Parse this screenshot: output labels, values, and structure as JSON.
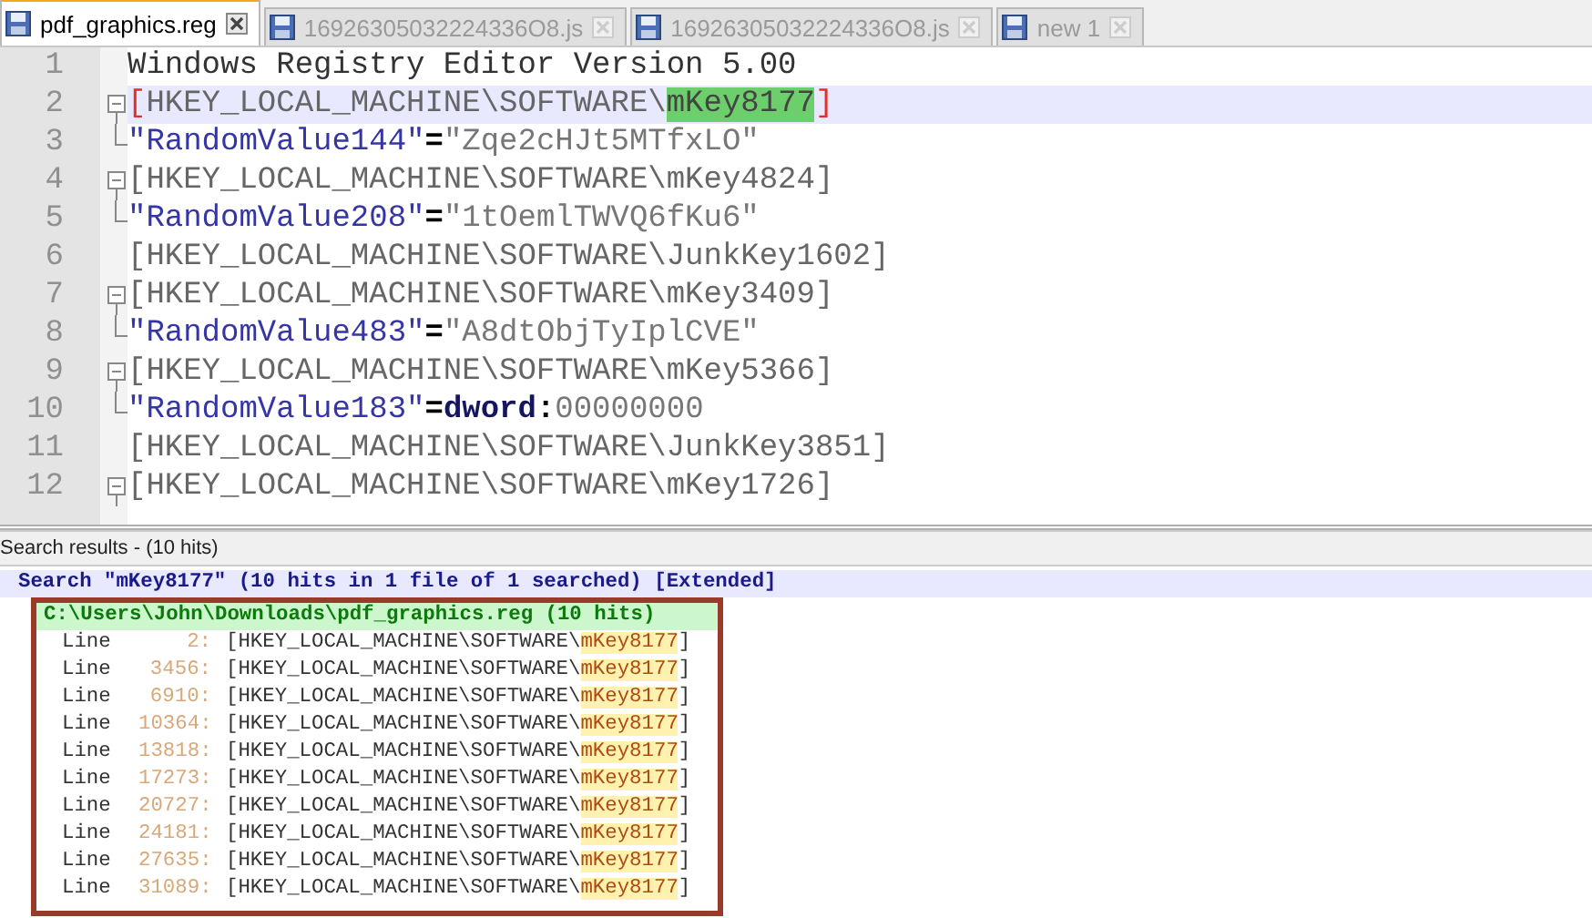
{
  "tabs": [
    {
      "label": "pdf_graphics.reg",
      "selected": true
    },
    {
      "label": "16926305032224336O8.js",
      "selected": false
    },
    {
      "label": "16926305032224336O8.js",
      "selected": false
    },
    {
      "label": "new 1",
      "selected": false
    }
  ],
  "editor": {
    "lines": [
      {
        "number": "1",
        "current": false,
        "segments": [
          {
            "kind": "plain",
            "text": "Windows Registry Editor Version 5.00"
          }
        ]
      },
      {
        "number": "2",
        "kind": "fold-start",
        "current": true,
        "segments": [
          {
            "kind": "brace",
            "text": "["
          },
          {
            "kind": "key",
            "text": "HKEY_LOCAL_MACHINE\\SOFTWARE\\"
          },
          {
            "kind": "match",
            "text": "mKey8177"
          },
          {
            "kind": "brace",
            "text": "]"
          }
        ]
      },
      {
        "number": "3",
        "kind": "fold-end",
        "current": false,
        "segments": [
          {
            "kind": "name",
            "text": "\"RandomValue144\""
          },
          {
            "kind": "op",
            "text": "="
          },
          {
            "kind": "string",
            "text": "\"Zqe2cHJt5MTfxLO\""
          }
        ]
      },
      {
        "number": "4",
        "kind": "fold-start",
        "current": false,
        "segments": [
          {
            "kind": "key",
            "text": "[HKEY_LOCAL_MACHINE\\SOFTWARE\\mKey4824]"
          }
        ]
      },
      {
        "number": "5",
        "kind": "fold-end",
        "current": false,
        "segments": [
          {
            "kind": "name",
            "text": "\"RandomValue208\""
          },
          {
            "kind": "op",
            "text": "="
          },
          {
            "kind": "string",
            "text": "\"1tOemlTWVQ6fKu6\""
          }
        ]
      },
      {
        "number": "6",
        "current": false,
        "segments": [
          {
            "kind": "key",
            "text": "[HKEY_LOCAL_MACHINE\\SOFTWARE\\JunkKey1602]"
          }
        ]
      },
      {
        "number": "7",
        "kind": "fold-start",
        "current": false,
        "segments": [
          {
            "kind": "key",
            "text": "[HKEY_LOCAL_MACHINE\\SOFTWARE\\mKey3409]"
          }
        ]
      },
      {
        "number": "8",
        "kind": "fold-end",
        "current": false,
        "segments": [
          {
            "kind": "name",
            "text": "\"RandomValue483\""
          },
          {
            "kind": "op",
            "text": "="
          },
          {
            "kind": "string",
            "text": "\"A8dtObjTyIplCVE\""
          }
        ]
      },
      {
        "number": "9",
        "kind": "fold-start",
        "current": false,
        "segments": [
          {
            "kind": "key",
            "text": "[HKEY_LOCAL_MACHINE\\SOFTWARE\\mKey5366]"
          }
        ]
      },
      {
        "number": "10",
        "kind": "fold-end",
        "current": false,
        "segments": [
          {
            "kind": "name",
            "text": "\"RandomValue183\""
          },
          {
            "kind": "op",
            "text": "="
          },
          {
            "kind": "type",
            "text": "dword"
          },
          {
            "kind": "op",
            "text": ":"
          },
          {
            "kind": "string",
            "text": "00000000"
          }
        ]
      },
      {
        "number": "11",
        "current": false,
        "segments": [
          {
            "kind": "key",
            "text": "[HKEY_LOCAL_MACHINE\\SOFTWARE\\JunkKey3851]"
          }
        ]
      },
      {
        "number": "12",
        "kind": "fold-start",
        "current": false,
        "segments": [
          {
            "kind": "key",
            "text": "[HKEY_LOCAL_MACHINE\\SOFTWARE\\mKey1726]"
          }
        ]
      }
    ]
  },
  "search_results": {
    "title": "Search results - (10 hits)",
    "query_line": "Search \"mKey8177\" (10 hits in 1 file of 1 searched) [Extended]",
    "file_line": "C:\\Users\\John\\Downloads\\pdf_graphics.reg (10 hits)",
    "hits": [
      {
        "label": "Line",
        "line": "2:",
        "text": "[HKEY_LOCAL_MACHINE\\SOFTWARE\\",
        "match": "mKey8177",
        "tail": "]"
      },
      {
        "label": "Line",
        "line": "3456:",
        "text": "[HKEY_LOCAL_MACHINE\\SOFTWARE\\",
        "match": "mKey8177",
        "tail": "]"
      },
      {
        "label": "Line",
        "line": "6910:",
        "text": "[HKEY_LOCAL_MACHINE\\SOFTWARE\\",
        "match": "mKey8177",
        "tail": "]"
      },
      {
        "label": "Line",
        "line": "10364:",
        "text": "[HKEY_LOCAL_MACHINE\\SOFTWARE\\",
        "match": "mKey8177",
        "tail": "]"
      },
      {
        "label": "Line",
        "line": "13818:",
        "text": "[HKEY_LOCAL_MACHINE\\SOFTWARE\\",
        "match": "mKey8177",
        "tail": "]"
      },
      {
        "label": "Line",
        "line": "17273:",
        "text": "[HKEY_LOCAL_MACHINE\\SOFTWARE\\",
        "match": "mKey8177",
        "tail": "]"
      },
      {
        "label": "Line",
        "line": "20727:",
        "text": "[HKEY_LOCAL_MACHINE\\SOFTWARE\\",
        "match": "mKey8177",
        "tail": "]"
      },
      {
        "label": "Line",
        "line": "24181:",
        "text": "[HKEY_LOCAL_MACHINE\\SOFTWARE\\",
        "match": "mKey8177",
        "tail": "]"
      },
      {
        "label": "Line",
        "line": "27635:",
        "text": "[HKEY_LOCAL_MACHINE\\SOFTWARE\\",
        "match": "mKey8177",
        "tail": "]"
      },
      {
        "label": "Line",
        "line": "31089:",
        "text": "[HKEY_LOCAL_MACHINE\\SOFTWARE\\",
        "match": "mKey8177",
        "tail": "]"
      }
    ]
  }
}
